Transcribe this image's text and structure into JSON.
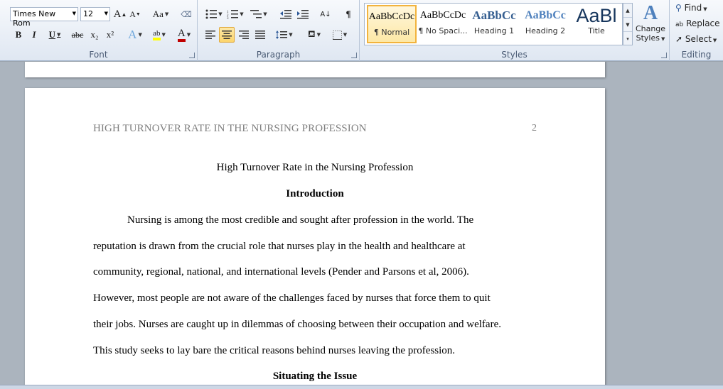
{
  "ribbon": {
    "font": {
      "label": "Font",
      "font_name": "Times New Rom",
      "font_size": "12",
      "grow_font": "A",
      "shrink_font": "A",
      "change_case": "Aa",
      "bold": "B",
      "italic": "I",
      "underline": "U",
      "strikethrough": "abc",
      "subscript": "x₂",
      "superscript": "x²",
      "text_effects": "A",
      "highlight": "ab",
      "font_color": "A"
    },
    "paragraph": {
      "label": "Paragraph",
      "show_marks": "¶"
    },
    "styles": {
      "label": "Styles",
      "items": [
        {
          "preview": "AaBbCcDc",
          "name": "¶ Normal"
        },
        {
          "preview": "AaBbCcDc",
          "name": "¶ No Spaci..."
        },
        {
          "preview": "AaBbCc",
          "name": "Heading 1"
        },
        {
          "preview": "AaBbCc",
          "name": "Heading 2"
        },
        {
          "preview": "AaBl",
          "name": "Title"
        }
      ],
      "change_styles_line1": "Change",
      "change_styles_line2": "Styles"
    },
    "editing": {
      "label": "Editing",
      "find": "Find",
      "replace": "Replace",
      "select": "Select"
    }
  },
  "document": {
    "running_header": "HIGH TURNOVER RATE IN THE NURSING PROFESSION",
    "page_number": "2",
    "title": "High Turnover Rate in the Nursing Profession",
    "intro_heading": "Introduction",
    "paragraph_lines": [
      "Nursing is among the most credible and sought after profession in the world. The",
      "reputation is drawn from the crucial role that nurses play in the health and healthcare at",
      "community, regional, national, and international levels (Pender and Parsons et al, 2006).",
      "However, most people are not aware of the challenges faced by nurses that force them to quit",
      "their jobs. Nurses are caught up in dilemmas of choosing between their occupation and welfare.",
      "This study seeks to lay bare the critical reasons behind nurses leaving the profession."
    ],
    "issue_heading": "Situating the Issue"
  },
  "colors": {
    "accent": "#f2b33d",
    "heading_blue": "#4f81bd",
    "ribbon_bg": "#dfe7f2"
  }
}
